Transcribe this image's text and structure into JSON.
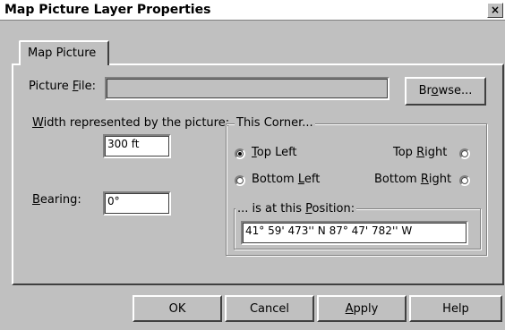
{
  "window": {
    "title": "Map Picture Layer Properties",
    "close_glyph": "×"
  },
  "tabs": [
    {
      "label": "Map Picture",
      "selected": true
    }
  ],
  "picture_file": {
    "label_pre": "Picture ",
    "label_key": "F",
    "label_post": "ile:",
    "value": "",
    "browse_pre": "Br",
    "browse_key": "o",
    "browse_post": "wse..."
  },
  "width": {
    "label_pre": "",
    "label_key": "W",
    "label_post": "idth represented by the picture:",
    "value": "300 ft"
  },
  "bearing": {
    "label_pre": "",
    "label_key": "B",
    "label_post": "earing:",
    "value": "0°"
  },
  "corner_group": {
    "title": "This Corner...",
    "options": [
      {
        "pre": "",
        "key": "T",
        "post": "op Left",
        "checked": true
      },
      {
        "pre": "Top ",
        "key": "R",
        "post": "ight",
        "checked": false
      },
      {
        "pre": "Bottom ",
        "key": "L",
        "post": "eft",
        "checked": false
      },
      {
        "pre": "Bottom ",
        "key": "R",
        "post": "ight",
        "checked": false
      }
    ]
  },
  "position_group": {
    "title_pre": "... is at this ",
    "title_key": "P",
    "title_post": "osition:",
    "value": "41°  59' 473'' N 87° 47' 782'' W"
  },
  "buttons": {
    "ok": "OK",
    "cancel": "Cancel",
    "apply_key": "A",
    "apply_post": "pply",
    "help": "Help"
  }
}
